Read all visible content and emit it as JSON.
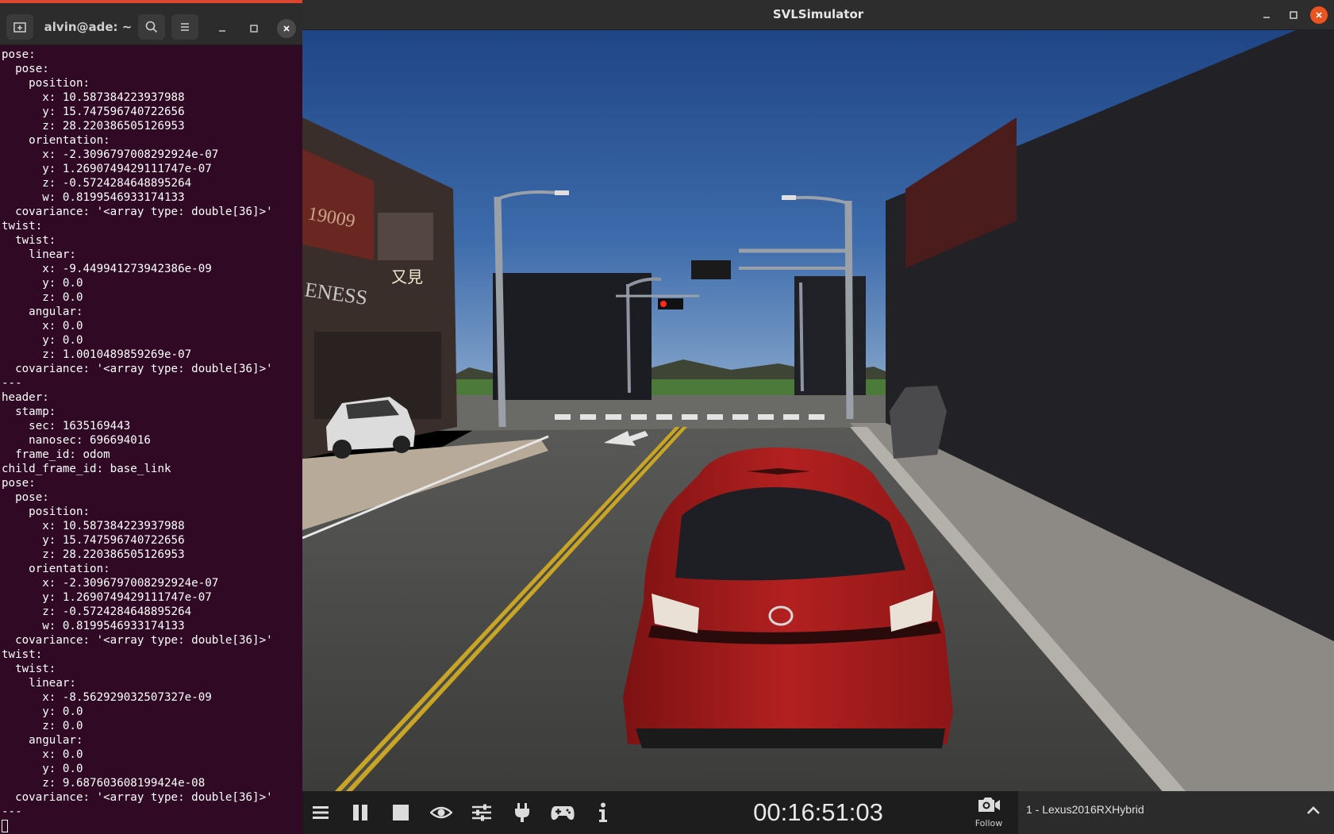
{
  "terminal": {
    "title": "alvin@ade: ~",
    "output": "pose:\n  pose:\n    position:\n      x: 10.587384223937988\n      y: 15.747596740722656\n      z: 28.220386505126953\n    orientation:\n      x: -2.3096797008292924e-07\n      y: 1.2690749429111747e-07\n      z: -0.5724284648895264\n      w: 0.8199546933174133\n  covariance: '<array type: double[36]>'\ntwist:\n  twist:\n    linear:\n      x: -9.449941273942386e-09\n      y: 0.0\n      z: 0.0\n    angular:\n      x: 0.0\n      y: 0.0\n      z: 1.0010489859269e-07\n  covariance: '<array type: double[36]>'\n---\nheader:\n  stamp:\n    sec: 1635169443\n    nanosec: 696694016\n  frame_id: odom\nchild_frame_id: base_link\npose:\n  pose:\n    position:\n      x: 10.587384223937988\n      y: 15.747596740722656\n      z: 28.220386505126953\n    orientation:\n      x: -2.3096797008292924e-07\n      y: 1.2690749429111747e-07\n      z: -0.5724284648895264\n      w: 0.8199546933174133\n  covariance: '<array type: double[36]>'\ntwist:\n  twist:\n    linear:\n      x: -8.562929032507327e-09\n      y: 0.0\n      z: 0.0\n    angular:\n      x: 0.0\n      y: 0.0\n      z: 9.687603608199424e-08\n  covariance: '<array type: double[36]>'\n---"
  },
  "simulator": {
    "title": "SVLSimulator",
    "clock": "00:16:51:03",
    "follow_label": "Follow",
    "vehicle": "1 - Lexus2016RXHybrid",
    "scene": {
      "storefront_number": "19009",
      "storefront_text": "ENESS",
      "storefront_cjk": "又見"
    }
  },
  "colors": {
    "terminal_bg": "#300a24",
    "terminal_accent": "#d9452d",
    "car": "#a51a1a",
    "sky": "#2e5a9a",
    "toolbar_bg": "#1d1d1d"
  }
}
